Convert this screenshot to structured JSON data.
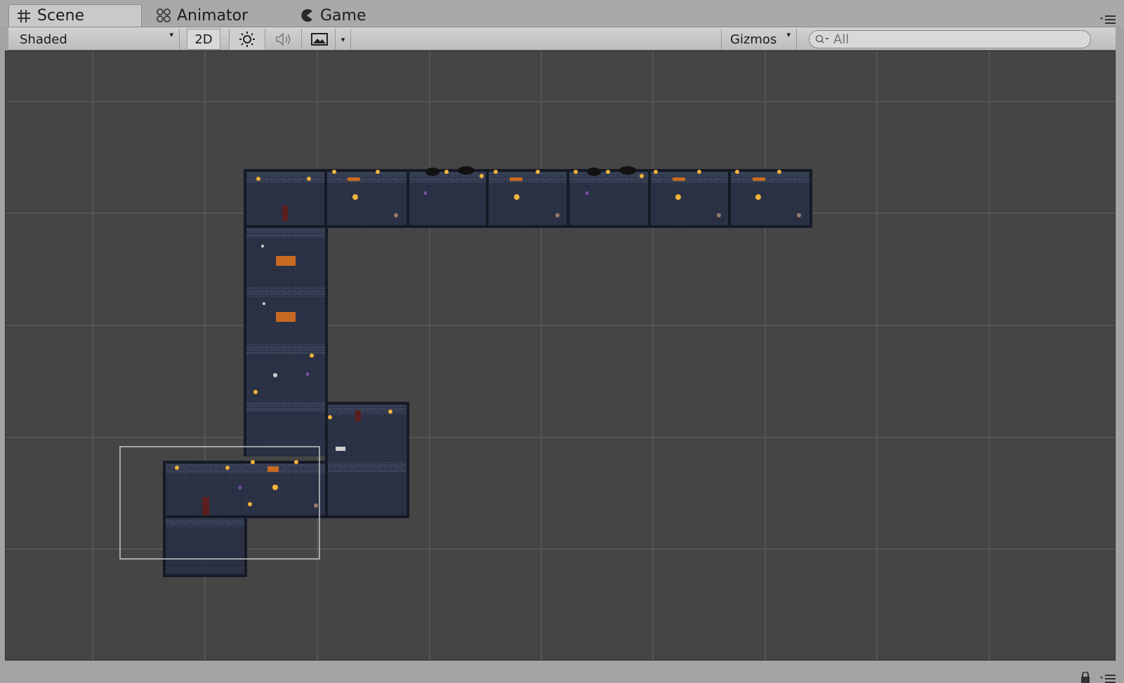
{
  "tabs": [
    {
      "label": "Scene",
      "icon": "grid-hash-icon",
      "active": true
    },
    {
      "label": "Animator",
      "icon": "animator-nodes-icon",
      "active": false
    },
    {
      "label": "Game",
      "icon": "pacman-icon",
      "active": false
    }
  ],
  "toolbar": {
    "shading_mode": "Shaded",
    "mode_2d": "2D",
    "lighting_icon": "sun-icon",
    "audio_icon": "speaker-icon",
    "effects_icon": "image-icon",
    "gizmos": "Gizmos",
    "search_placeholder": "All"
  },
  "scene": {
    "background_color": "#454545",
    "grid_color": "#5a5a5a",
    "tile_color": "#2b3145",
    "wall_color": "#1b2030",
    "torch_color": "#f2b23a",
    "camera_frame_color": "#c8c8c8"
  }
}
